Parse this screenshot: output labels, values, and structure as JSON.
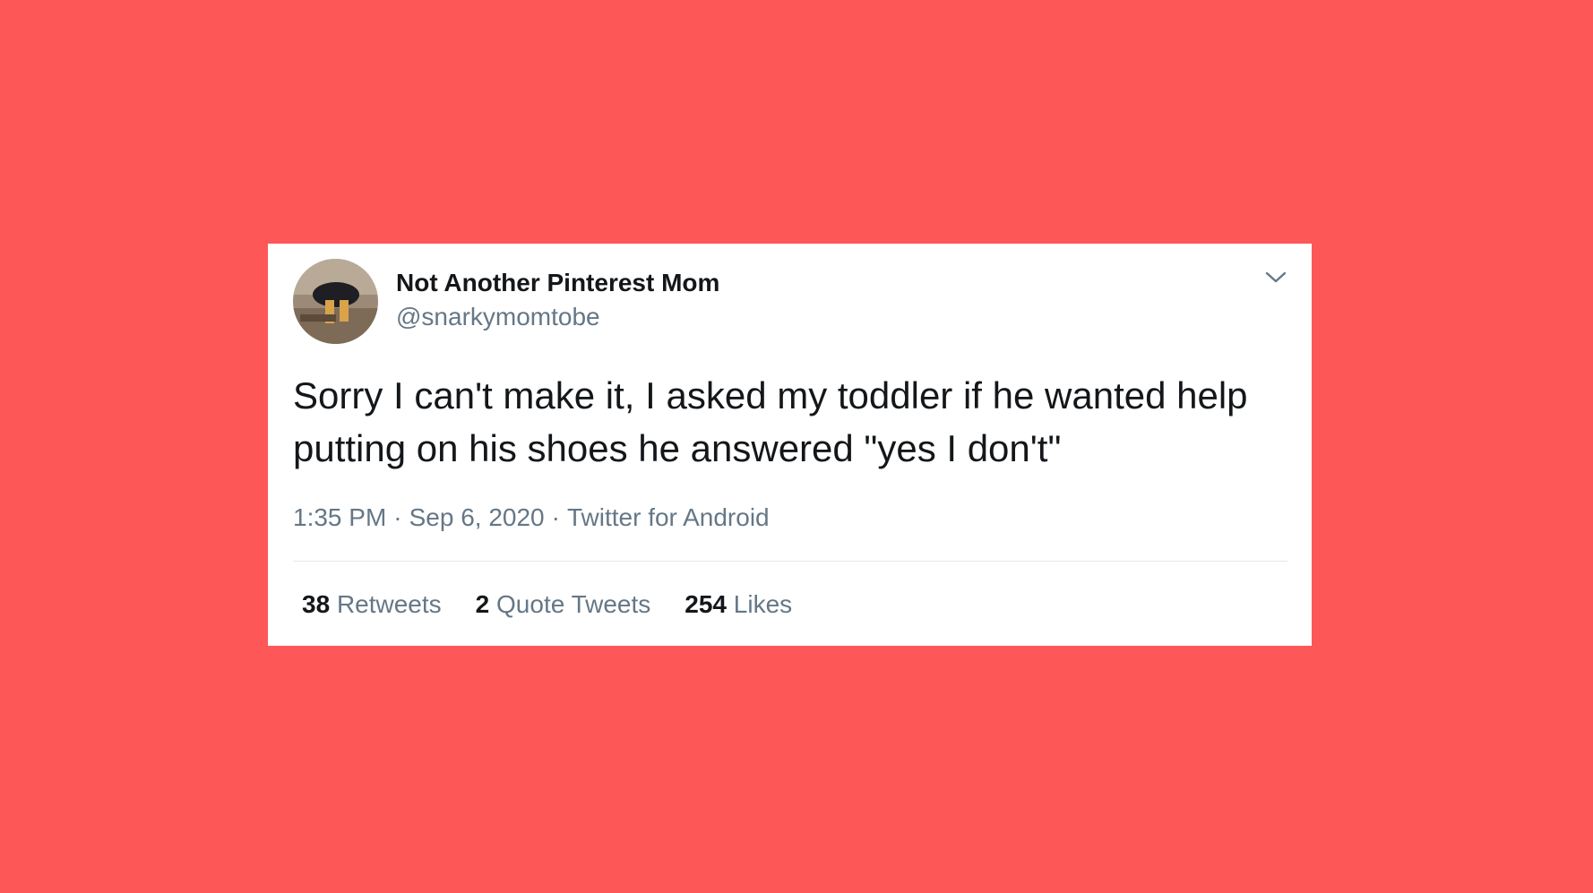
{
  "colors": {
    "background": "#fd5757",
    "card": "#ffffff",
    "text_primary": "#14171a",
    "text_secondary": "#657786",
    "divider": "#e1e8ed"
  },
  "tweet": {
    "author": {
      "display_name": "Not Another Pinterest Mom",
      "handle": "@snarkymomtobe",
      "avatar_icon": "avatar-photo"
    },
    "menu_icon": "chevron-down-icon",
    "text": "Sorry I can't make it, I asked my toddler if he wanted help putting on his shoes he answered \"yes I don't\"",
    "time": "1:35 PM",
    "date": "Sep 6, 2020",
    "source": "Twitter for Android",
    "separator": "·",
    "stats": {
      "retweets_count": "38",
      "retweets_label": "Retweets",
      "quotes_count": "2",
      "quotes_label": "Quote Tweets",
      "likes_count": "254",
      "likes_label": "Likes"
    }
  }
}
